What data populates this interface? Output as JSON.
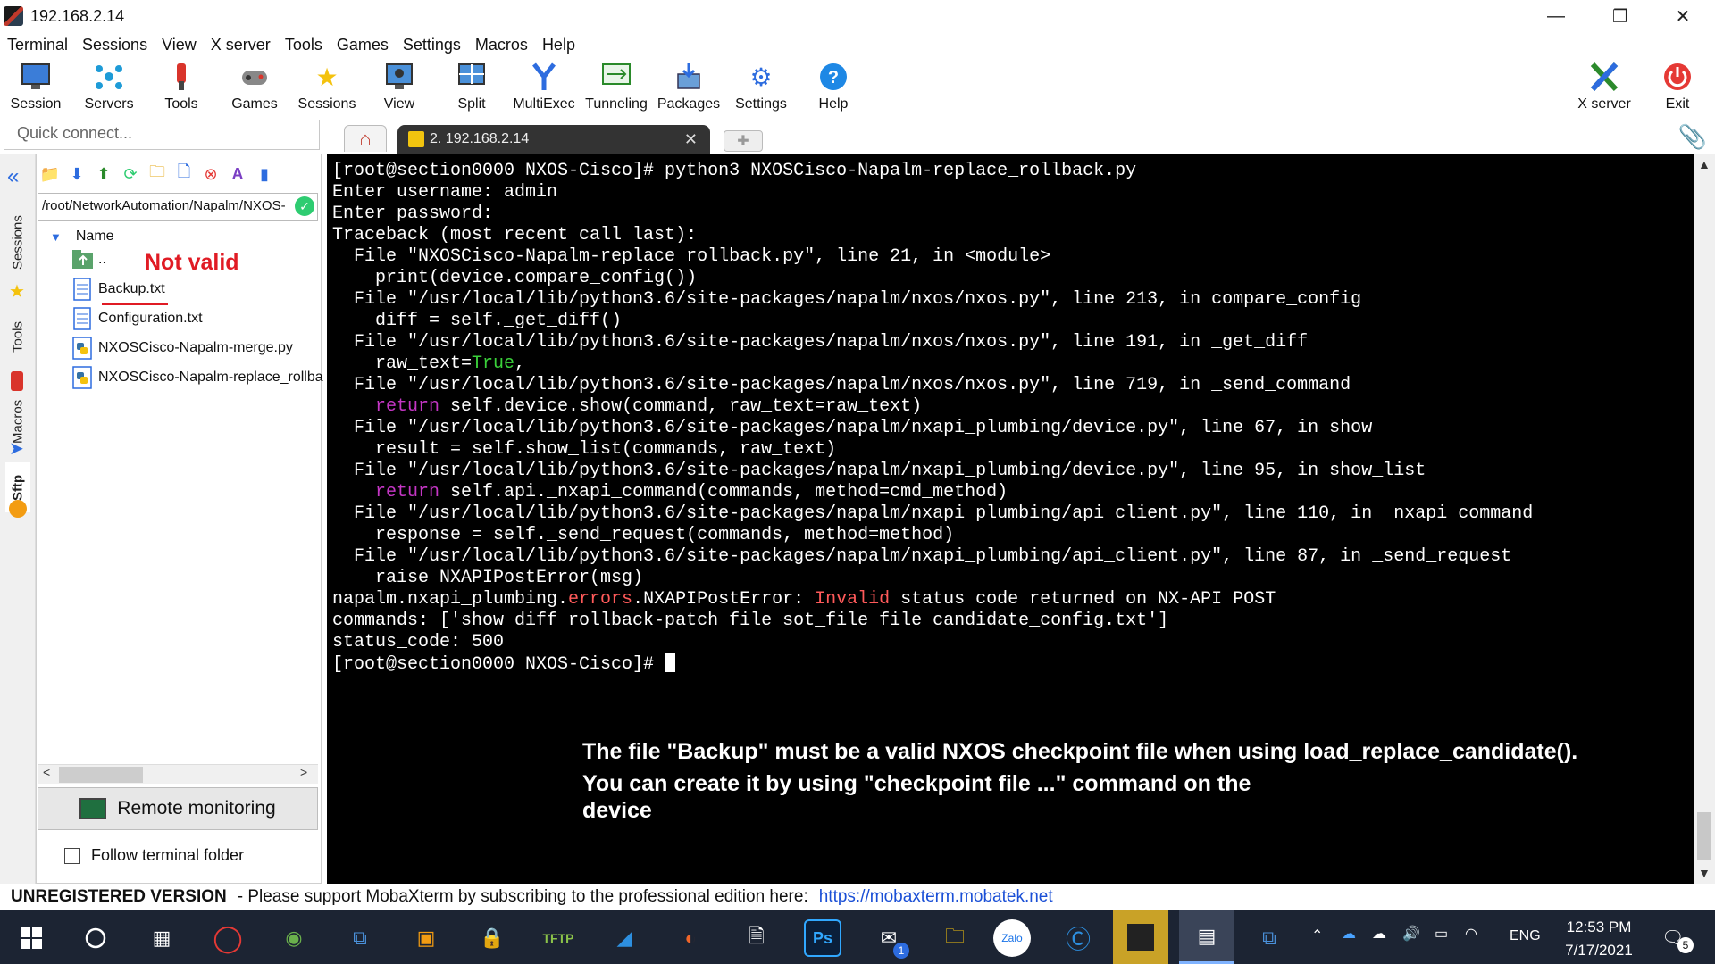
{
  "window": {
    "title": "192.168.2.14",
    "minimize_glyph": "—",
    "maximize_glyph": "❐",
    "close_glyph": "✕"
  },
  "menu": [
    "Terminal",
    "Sessions",
    "View",
    "X server",
    "Tools",
    "Games",
    "Settings",
    "Macros",
    "Help"
  ],
  "toolbar": {
    "session": "Session",
    "servers": "Servers",
    "tools": "Tools",
    "games": "Games",
    "sessions": "Sessions",
    "view": "View",
    "split": "Split",
    "multiexec": "MultiExec",
    "tunneling": "Tunneling",
    "packages": "Packages",
    "settings": "Settings",
    "help": "Help",
    "xserver": "X server",
    "exit": "Exit"
  },
  "quick_connect": {
    "placeholder": "Quick connect..."
  },
  "tabs": {
    "active_label": "2. 192.168.2.14"
  },
  "side_tabs": [
    "Sessions",
    "Tools",
    "Macros",
    "Sftp"
  ],
  "sftp": {
    "path": "/root/NetworkAutomation/Napalm/NXOS-",
    "column_name": "Name",
    "files": [
      "..",
      "Backup.txt",
      "Configuration.txt",
      "NXOSCisco-Napalm-merge.py",
      "NXOSCisco-Napalm-replace_rollba"
    ],
    "annotation": "Not valid",
    "remote_monitoring": "Remote monitoring",
    "follow_terminal": "Follow terminal folder"
  },
  "terminal": {
    "l01": "[root@section0000 NXOS-Cisco]# python3 NXOSCisco-Napalm-replace_rollback.py",
    "l02": "Enter username: admin",
    "l03": "Enter password:",
    "l04": "Traceback (most recent call last):",
    "l05": "  File \"NXOSCisco-Napalm-replace_rollback.py\", line 21, in <module>",
    "l06": "    print(device.compare_config())",
    "l07": "  File \"/usr/local/lib/python3.6/site-packages/napalm/nxos/nxos.py\", line 213, in compare_config",
    "l08": "    diff = self._get_diff()",
    "l09": "  File \"/usr/local/lib/python3.6/site-packages/napalm/nxos/nxos.py\", line 191, in _get_diff",
    "l10a": "    raw_text=",
    "l10b": "True",
    "l10c": ",",
    "l11": "  File \"/usr/local/lib/python3.6/site-packages/napalm/nxos/nxos.py\", line 719, in _send_command",
    "l12a": "    ",
    "l12b": "return",
    "l12c": " self.device.show(command, raw_text=raw_text)",
    "l13": "  File \"/usr/local/lib/python3.6/site-packages/napalm/nxapi_plumbing/device.py\", line 67, in show",
    "l14": "    result = self.show_list(commands, raw_text)",
    "l15": "  File \"/usr/local/lib/python3.6/site-packages/napalm/nxapi_plumbing/device.py\", line 95, in show_list",
    "l16a": "    ",
    "l16b": "return",
    "l16c": " self.api._nxapi_command(commands, method=cmd_method)",
    "l17": "  File \"/usr/local/lib/python3.6/site-packages/napalm/nxapi_plumbing/api_client.py\", line 110, in _nxapi_command",
    "l18": "    response = self._send_request(commands, method=method)",
    "l19": "  File \"/usr/local/lib/python3.6/site-packages/napalm/nxapi_plumbing/api_client.py\", line 87, in _send_request",
    "l20": "    raise NXAPIPostError(msg)",
    "l21a": "napalm.nxapi_plumbing.",
    "l21b": "errors",
    "l21c": ".NXAPIPostError: ",
    "l21d": "Invalid",
    "l21e": " status code returned on NX-API POST",
    "l22": "commands: ['show diff rollback-patch file sot_file file candidate_config.txt']",
    "l23": "status_code: 500",
    "l24": "[root@section0000 NXOS-Cisco]# "
  },
  "note": {
    "line1": "The file \"Backup\" must be a valid NXOS checkpoint file  when using load_replace_candidate().",
    "line2": "You can create it by using \"checkpoint file ...\" command on the",
    "line3": "device"
  },
  "status": {
    "unregistered": "UNREGISTERED VERSION",
    "message": "-  Please support MobaXterm by subscribing to the professional edition here:",
    "link": "https://mobaxterm.mobatek.net"
  },
  "taskbar": {
    "lang": "ENG",
    "time": "12:53 PM",
    "date": "7/17/2021",
    "notif_count": "5",
    "mail_badge": "1"
  },
  "colors": {
    "terminal_bg": "#000000",
    "terminal_fg": "#ffffff",
    "keyword": "#c436c4",
    "true_literal": "#3ad13a",
    "error_red": "#ff5a5a",
    "annotation_red": "#e01b24",
    "link_blue": "#1a4fd6",
    "taskbar_bg": "#1c2433"
  }
}
